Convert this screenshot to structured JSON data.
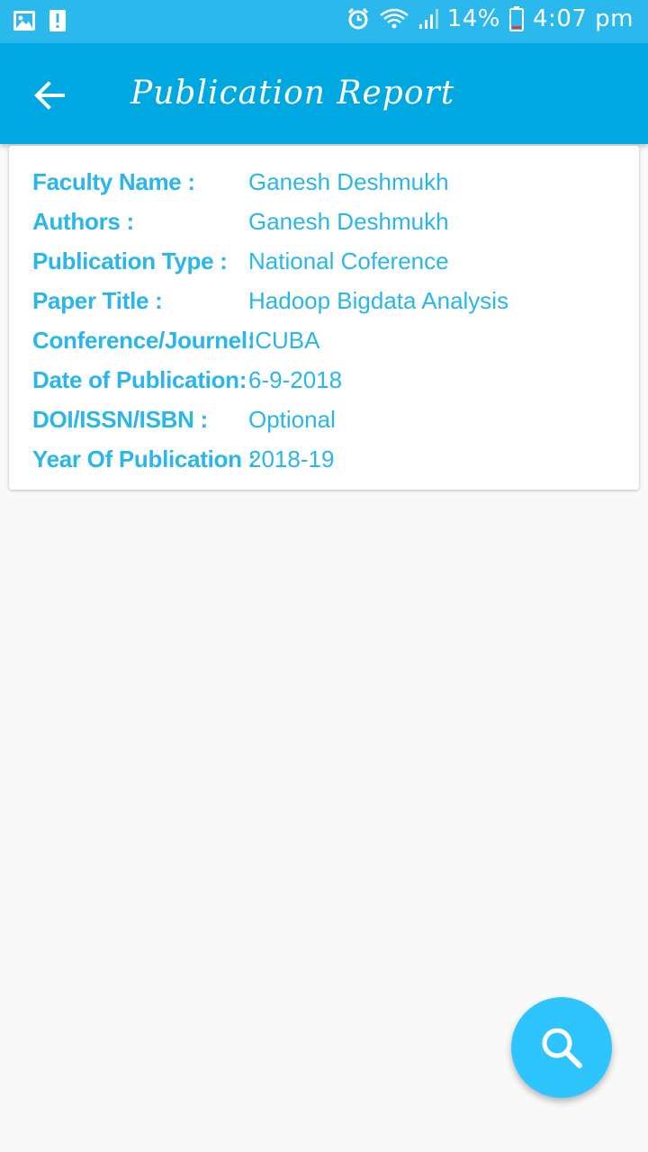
{
  "status_bar": {
    "battery": "14%",
    "time": "4:07 pm",
    "icons": [
      "image-icon",
      "alert-icon",
      "alarm-icon",
      "wifi-icon",
      "signal-icon",
      "battery-icon"
    ]
  },
  "app_bar": {
    "title": "Publication Report",
    "back_icon": "arrow-back-icon"
  },
  "details": [
    {
      "label": "Faculty Name :",
      "value": "Ganesh Deshmukh"
    },
    {
      "label": "Authors :",
      "value": "Ganesh Deshmukh"
    },
    {
      "label": "Publication Type :",
      "value": "National Coference"
    },
    {
      "label": "Paper Title :",
      "value": "Hadoop Bigdata Analysis"
    },
    {
      "label": "Conference/Journel:",
      "value": "ICUBA"
    },
    {
      "label": "Date of Publication:",
      "value": "6-9-2018"
    },
    {
      "label": "DOI/ISSN/ISBN :",
      "value": "Optional"
    },
    {
      "label": "Year Of Publication :",
      "value": "2018-19"
    }
  ],
  "fab": {
    "icon": "search-icon"
  },
  "colors": {
    "status_bar": "#2bb8ec",
    "app_bar": "#00a8e2",
    "text_accent": "#29b6ea",
    "fab": "#2ec5ff",
    "background": "#f9f9f9"
  }
}
